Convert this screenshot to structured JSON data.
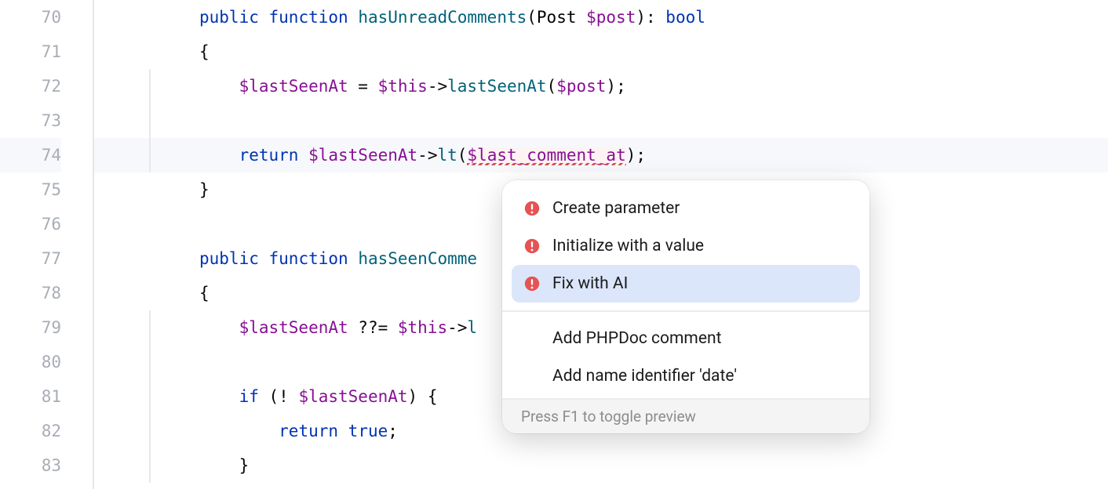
{
  "gutter": {
    "start": 70,
    "end": 83
  },
  "code": {
    "lines": [
      {
        "n": 70,
        "indent": 1,
        "segs": [
          {
            "t": "public ",
            "c": "tok-kw"
          },
          {
            "t": "function ",
            "c": "tok-kw"
          },
          {
            "t": "hasUnreadComments",
            "c": "tok-fn"
          },
          {
            "t": "(",
            "c": "tok-punc"
          },
          {
            "t": "Post ",
            "c": "tok-default"
          },
          {
            "t": "$post",
            "c": "tok-var"
          },
          {
            "t": ")",
            "c": "tok-punc"
          },
          {
            "t": ": ",
            "c": "tok-punc"
          },
          {
            "t": "bool",
            "c": "tok-type"
          }
        ]
      },
      {
        "n": 71,
        "indent": 1,
        "segs": [
          {
            "t": "{",
            "c": "tok-punc"
          }
        ]
      },
      {
        "n": 72,
        "indent": 1,
        "guide": true,
        "pad": "    ",
        "segs": [
          {
            "t": "$lastSeenAt",
            "c": "tok-var"
          },
          {
            "t": " = ",
            "c": "tok-op"
          },
          {
            "t": "$this",
            "c": "tok-var"
          },
          {
            "t": "->",
            "c": "tok-op"
          },
          {
            "t": "lastSeenAt",
            "c": "tok-fn"
          },
          {
            "t": "(",
            "c": "tok-punc"
          },
          {
            "t": "$post",
            "c": "tok-var"
          },
          {
            "t": ");",
            "c": "tok-punc"
          }
        ]
      },
      {
        "n": 73,
        "indent": 1,
        "guide": true,
        "segs": []
      },
      {
        "n": 74,
        "indent": 1,
        "guide": true,
        "hl": true,
        "pad": "    ",
        "segs": [
          {
            "t": "return ",
            "c": "tok-kw"
          },
          {
            "t": "$lastSeenAt",
            "c": "tok-var"
          },
          {
            "t": "->",
            "c": "tok-op"
          },
          {
            "t": "lt",
            "c": "tok-fn"
          },
          {
            "t": "(",
            "c": "tok-punc"
          },
          {
            "t": "$last_comment_at",
            "c": "tok-var",
            "err": true
          },
          {
            "t": ");",
            "c": "tok-punc"
          }
        ]
      },
      {
        "n": 75,
        "indent": 1,
        "segs": [
          {
            "t": "}",
            "c": "tok-punc"
          }
        ]
      },
      {
        "n": 76,
        "indent": 0,
        "segs": []
      },
      {
        "n": 77,
        "indent": 1,
        "segs": [
          {
            "t": "public ",
            "c": "tok-kw"
          },
          {
            "t": "function ",
            "c": "tok-kw"
          },
          {
            "t": "hasSeenComme",
            "c": "tok-fn"
          }
        ]
      },
      {
        "n": 78,
        "indent": 1,
        "segs": [
          {
            "t": "{",
            "c": "tok-punc"
          }
        ]
      },
      {
        "n": 79,
        "indent": 1,
        "guide": true,
        "pad": "    ",
        "segs": [
          {
            "t": "$lastSeenAt",
            "c": "tok-var"
          },
          {
            "t": " ??= ",
            "c": "tok-op"
          },
          {
            "t": "$this",
            "c": "tok-var"
          },
          {
            "t": "->",
            "c": "tok-op"
          },
          {
            "t": "l",
            "c": "tok-fn"
          }
        ]
      },
      {
        "n": 80,
        "indent": 1,
        "guide": true,
        "segs": []
      },
      {
        "n": 81,
        "indent": 1,
        "guide": true,
        "pad": "    ",
        "segs": [
          {
            "t": "if ",
            "c": "tok-kw"
          },
          {
            "t": "(! ",
            "c": "tok-punc"
          },
          {
            "t": "$lastSeenAt",
            "c": "tok-var"
          },
          {
            "t": ") {",
            "c": "tok-punc"
          }
        ]
      },
      {
        "n": 82,
        "indent": 1,
        "guide": true,
        "pad": "        ",
        "segs": [
          {
            "t": "return ",
            "c": "tok-kw"
          },
          {
            "t": "true",
            "c": "tok-kw"
          },
          {
            "t": ";",
            "c": "tok-punc"
          }
        ]
      },
      {
        "n": 83,
        "indent": 1,
        "guide": true,
        "pad": "    ",
        "segs": [
          {
            "t": "}",
            "c": "tok-punc"
          }
        ]
      }
    ]
  },
  "popup": {
    "items_primary": [
      {
        "label": "Create parameter",
        "icon": true,
        "selected": false
      },
      {
        "label": "Initialize with a value",
        "icon": true,
        "selected": false
      },
      {
        "label": "Fix with AI",
        "icon": true,
        "selected": true
      }
    ],
    "items_secondary": [
      {
        "label": "Add PHPDoc comment",
        "icon": false
      },
      {
        "label": "Add name identifier 'date'",
        "icon": false
      }
    ],
    "footer": "Press F1 to toggle preview"
  }
}
